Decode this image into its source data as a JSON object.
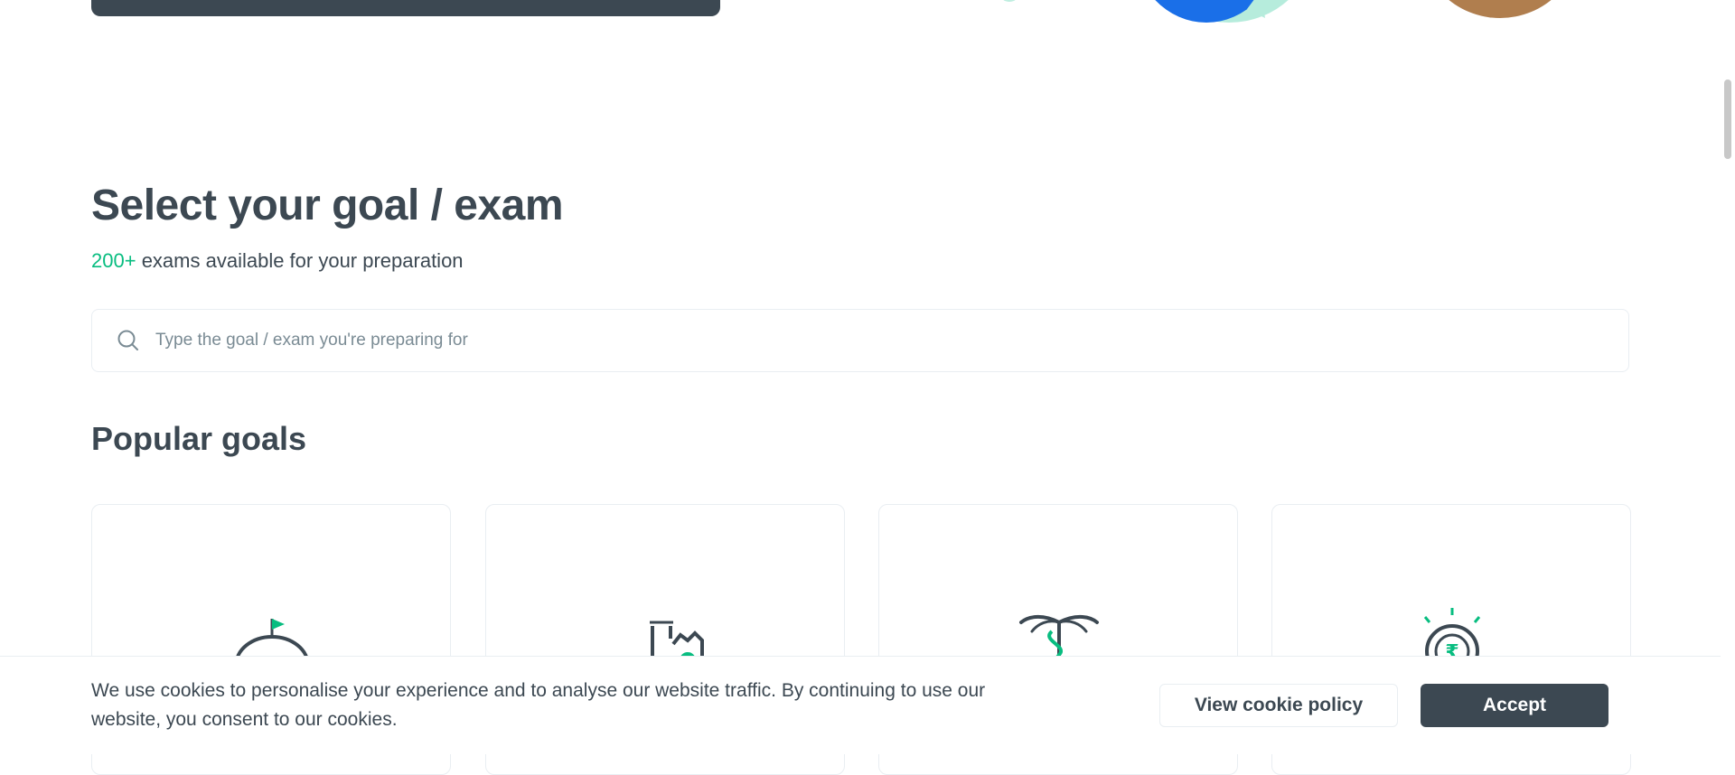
{
  "goal_section": {
    "title": "Select your goal / exam",
    "subtitle_count": "200+",
    "subtitle_text": "exams available for your preparation",
    "search_placeholder": "Type the goal / exam you're preparing for",
    "search_icon": "search-icon"
  },
  "popular": {
    "title": "Popular goals",
    "cards": [
      {
        "icon": "cloche-flag-icon"
      },
      {
        "icon": "factory-gear-icon"
      },
      {
        "icon": "caduceus-icon"
      },
      {
        "icon": "rupee-coin-icon"
      }
    ]
  },
  "cookie": {
    "message": "We use cookies to personalise your experience and to analyse our website traffic. By continuing to use our website, you consent to our cookies.",
    "view_policy_label": "View cookie policy",
    "accept_label": "Accept"
  },
  "colors": {
    "text": "#3c4852",
    "accent": "#08bd80",
    "border": "#e9eef2",
    "button_dark": "#3c4852"
  }
}
